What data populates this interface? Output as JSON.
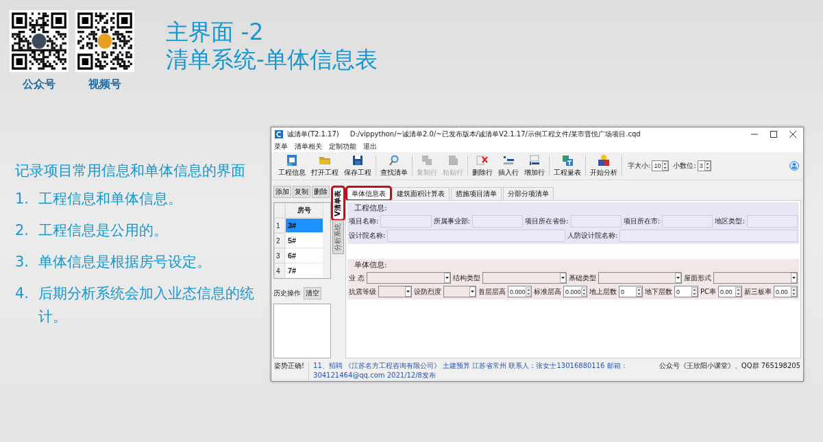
{
  "slide": {
    "qr_codes": [
      {
        "caption": "公众号"
      },
      {
        "caption": "视频号"
      }
    ],
    "title_lines": [
      "主界面 -2",
      "清单系统-单体信息表"
    ],
    "intro": "记录项目常用信息和单体信息的界面",
    "points": [
      {
        "number": "1.",
        "text": "工程信息和单体信息。"
      },
      {
        "number": "2.",
        "text": "工程信息是公用的。"
      },
      {
        "number": "3.",
        "text": "单体信息是根据房号设定。"
      },
      {
        "number": "4.",
        "text": "后期分析系统会加入业态信息的统计。"
      }
    ]
  },
  "window": {
    "title": "诚清单(T2.1.17)",
    "path": "D:/vippython/~诚清单2.0/~已发布版本/诚清单V2.1.17/示例工程文件/某市晋悦广场项目.cqd"
  },
  "menu": [
    "菜单",
    "清单相关",
    "定制功能",
    "退出"
  ],
  "toolbar": [
    {
      "kind": "button",
      "label": "工程信息",
      "disabled": false
    },
    {
      "kind": "button",
      "label": "打开工程",
      "disabled": false
    },
    {
      "kind": "button",
      "label": "保存工程",
      "disabled": false
    },
    {
      "kind": "separator"
    },
    {
      "kind": "button",
      "label": "查找清单",
      "disabled": false
    },
    {
      "kind": "separator"
    },
    {
      "kind": "button",
      "label": "复制行",
      "disabled": true
    },
    {
      "kind": "button",
      "label": "粘贴行",
      "disabled": true
    },
    {
      "kind": "separator"
    },
    {
      "kind": "button",
      "label": "删除行",
      "disabled": false
    },
    {
      "kind": "button",
      "label": "插入行",
      "disabled": false
    },
    {
      "kind": "button",
      "label": "增加行",
      "disabled": false
    },
    {
      "kind": "separator"
    },
    {
      "kind": "button",
      "label": "工程量表",
      "disabled": false
    },
    {
      "kind": "separator"
    },
    {
      "kind": "button",
      "label": "开始分析",
      "disabled": false
    },
    {
      "kind": "separator"
    }
  ],
  "spinners": [
    {
      "label": "字大小:",
      "value": "10"
    },
    {
      "label": "小数位:",
      "value": "3"
    }
  ],
  "left_panel": {
    "buttons": [
      "添加",
      "复制",
      "删除"
    ],
    "rooms": {
      "header": "房号",
      "rows": [
        {
          "index": "1",
          "room": "3#",
          "selected": true
        },
        {
          "index": "2",
          "room": "5#",
          "selected": false
        },
        {
          "index": "3",
          "room": "6#",
          "selected": false
        },
        {
          "index": "4",
          "room": "7#",
          "selected": false
        }
      ]
    },
    "history_label": "历史操作",
    "clear_button": "清空"
  },
  "side_tabs": [
    {
      "label": "V清单表",
      "selected": true,
      "highlighted": true
    },
    {
      "label": "分析系统",
      "selected": false,
      "highlighted": false
    }
  ],
  "tabs": [
    {
      "label": "单体信息表",
      "selected": true,
      "highlighted": true
    },
    {
      "label": "建筑面积计算表",
      "selected": false,
      "highlighted": false
    },
    {
      "label": "措施项目清单",
      "selected": false,
      "highlighted": false
    },
    {
      "label": "分部分项清单",
      "selected": false,
      "highlighted": false
    }
  ],
  "project_info": {
    "title": "工程信息:",
    "rows": [
      [
        {
          "label": "项目名称:"
        },
        {
          "label": "所属事业部:"
        },
        {
          "label": "项目所在省份:"
        },
        {
          "label": "项目所在市:"
        },
        {
          "label": "地区类型:"
        }
      ],
      [
        {
          "label": "设计院名称:"
        },
        {
          "label": "人防设计院名称:"
        }
      ]
    ]
  },
  "unit_info": {
    "title": "单体信息:",
    "rows": [
      [
        {
          "label": "业 态",
          "kind": "combo"
        },
        {
          "label": "结构类型",
          "kind": "combo"
        },
        {
          "label": "基础类型",
          "kind": "combo"
        },
        {
          "label": "屋面形式",
          "kind": "combo"
        }
      ],
      [
        {
          "label": "抗震等级",
          "kind": "combo"
        },
        {
          "label": "设防烈度",
          "kind": "combo"
        },
        {
          "label": "首层层高",
          "kind": "spin",
          "value": "0.000"
        },
        {
          "label": "标准层高",
          "kind": "spin",
          "value": "0.000"
        },
        {
          "label": "地上层数",
          "kind": "spin",
          "value": "0"
        },
        {
          "label": "地下层数",
          "kind": "spin",
          "value": "0"
        },
        {
          "label": "PC率",
          "kind": "spin",
          "value": "0.00"
        },
        {
          "label": "新三板率",
          "kind": "spin",
          "value": "0.00"
        }
      ]
    ]
  },
  "status_bar": {
    "left": "姿势正确!",
    "message": "11、招聘 《江苏名方工程咨询有限公司》 土建预算 江苏省常州 联系人：张女士13016880116 邮箱：304121464@qq.com 2021/12/8发布",
    "right": "公众号《王欣阳小课堂》、QQ群 765198205"
  }
}
